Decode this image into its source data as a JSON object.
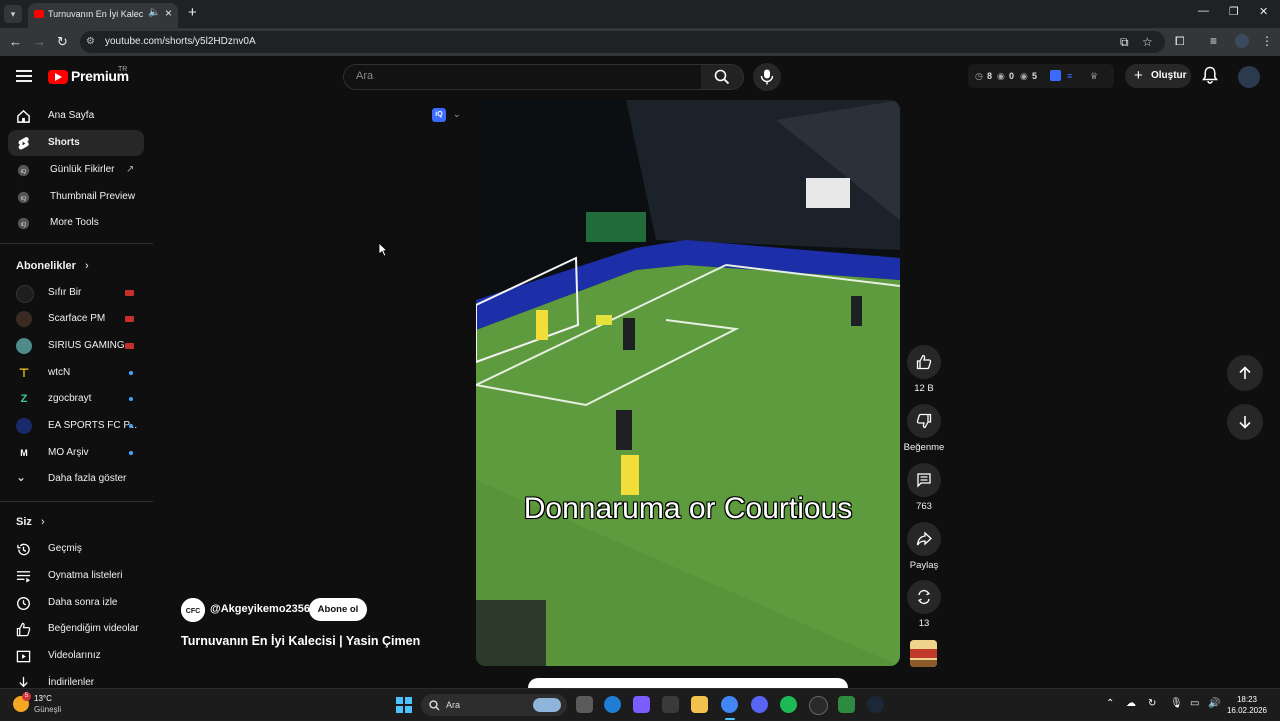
{
  "browser": {
    "tab_title": "Turnuvanın En İyi Kalecisi | Yasin Çimen",
    "url": "youtube.com/shorts/y5l2HDznv0A"
  },
  "masthead": {
    "brand": "Premium",
    "country": "TR",
    "search_placeholder": "Ara",
    "stat_1": "8",
    "stat_2": "0",
    "stat_3": "5",
    "create_label": "Oluştur"
  },
  "sidebar": {
    "nav": [
      {
        "label": "Ana Sayfa"
      },
      {
        "label": "Shorts"
      },
      {
        "label": "Günlük Fikirler"
      },
      {
        "label": "Thumbnail Preview"
      },
      {
        "label": "More Tools"
      }
    ],
    "subs_heading": "Abonelikler",
    "subscriptions": [
      {
        "label": "Sıfır Bir",
        "indicator": "live"
      },
      {
        "label": "Scarface PM",
        "indicator": "live"
      },
      {
        "label": "SIRIUS GAMING",
        "indicator": "live"
      },
      {
        "label": "wtcN",
        "indicator": "new"
      },
      {
        "label": "zgocbrayt",
        "indicator": "new"
      },
      {
        "label": "EA SPORTS FC P...",
        "indicator": "new"
      },
      {
        "label": "MO Arşiv",
        "indicator": "new"
      }
    ],
    "show_more": "Daha fazla göster",
    "you_heading": "Siz",
    "you_items": [
      {
        "label": "Geçmiş"
      },
      {
        "label": "Oynatma listeleri"
      },
      {
        "label": "Daha sonra izle"
      },
      {
        "label": "Beğendiğim videolar"
      },
      {
        "label": "Videolarınız"
      },
      {
        "label": "İndirilenler"
      }
    ]
  },
  "short": {
    "overlay_text": "Donnaruma or Courtious",
    "channel": "@Akgeyikemo2356",
    "subscribe_label": "Abone ol",
    "title": "Turnuvanın En İyi Kalecisi | Yasin Çimen",
    "likes": "12 B",
    "dislike_label": "Beğenme",
    "comments": "763",
    "share_label": "Paylaş",
    "remix": "13"
  },
  "taskbar": {
    "temperature": "13°C",
    "condition": "Güneşli",
    "weather_badge": "5",
    "search_label": "Ara",
    "time": "18:23",
    "date": "16.02.2026"
  }
}
